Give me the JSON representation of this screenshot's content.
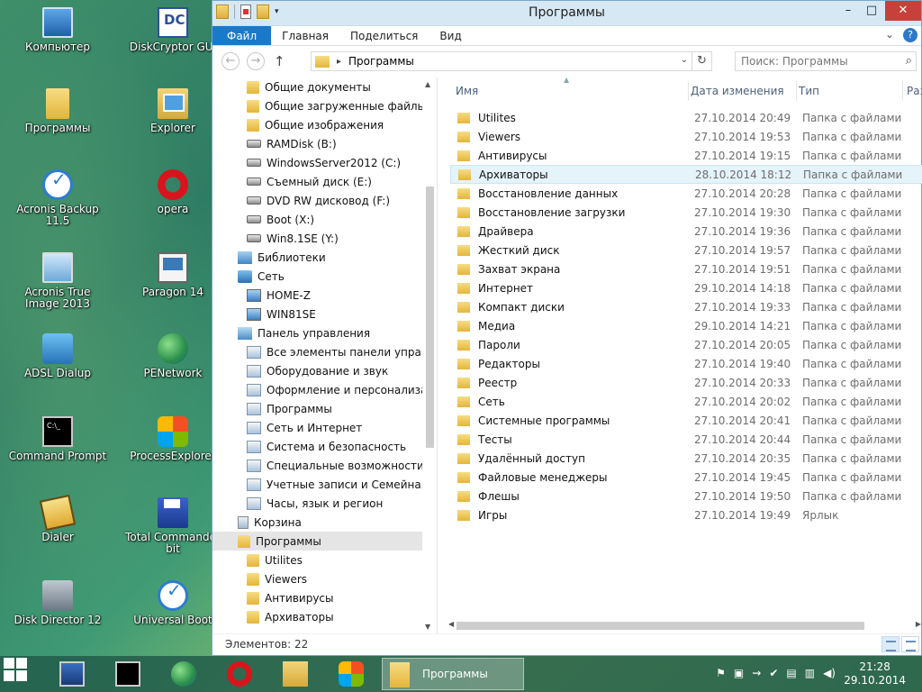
{
  "desktop": {
    "icons": [
      {
        "label": "Компьютер",
        "icon": "computer-icon"
      },
      {
        "label": "DiskCryptor GUI",
        "icon": "diskcryptor-icon"
      },
      {
        "label": "Программы",
        "icon": "folder-icon"
      },
      {
        "label": "Explorer",
        "icon": "explorer-icon"
      },
      {
        "label": "Acronis Backup 11.5",
        "icon": "acronis-icon"
      },
      {
        "label": "opera",
        "icon": "opera-icon"
      },
      {
        "label": "Acronis True Image 2013",
        "icon": "acronis-trueimage-icon"
      },
      {
        "label": "Paragon 14",
        "icon": "paragon-icon"
      },
      {
        "label": "ADSL Dialup",
        "icon": "network-icon"
      },
      {
        "label": "PENetwork",
        "icon": "globe-icon"
      },
      {
        "label": "Command Prompt",
        "icon": "cmd-icon"
      },
      {
        "label": "ProcessExplorer",
        "icon": "process-explorer-icon"
      },
      {
        "label": "Dialer",
        "icon": "dialer-icon"
      },
      {
        "label": "Total Commander bit",
        "icon": "total-commander-icon"
      },
      {
        "label": "Disk Director 12",
        "icon": "disk-director-icon"
      },
      {
        "label": "Universal Boot",
        "icon": "universal-boot-icon"
      }
    ]
  },
  "window": {
    "title": "Программы",
    "ribbon": {
      "tabs": [
        "Файл",
        "Главная",
        "Поделиться",
        "Вид"
      ]
    },
    "address": {
      "path": "Программы"
    },
    "search": {
      "placeholder": "Поиск: Программы"
    },
    "nav": {
      "items": [
        {
          "label": "Общие документы",
          "icon": "folder"
        },
        {
          "label": "Общие загруженные файлы",
          "icon": "folder"
        },
        {
          "label": "Общие изображения",
          "icon": "folder"
        },
        {
          "label": "RAMDisk (B:)",
          "icon": "drive"
        },
        {
          "label": "WindowsServer2012 (C:)",
          "icon": "drive"
        },
        {
          "label": "Съемный диск (E:)",
          "icon": "drive"
        },
        {
          "label": "DVD RW дисковод (F:)",
          "icon": "drive"
        },
        {
          "label": "Boot (X:)",
          "icon": "drive"
        },
        {
          "label": "Win8.1SE (Y:)",
          "icon": "drive"
        },
        {
          "label": "Библиотеки",
          "icon": "lib"
        },
        {
          "label": "Сеть",
          "icon": "netw"
        },
        {
          "label": "HOME-Z",
          "icon": "comp"
        },
        {
          "label": "WIN81SE",
          "icon": "comp"
        },
        {
          "label": "Панель управления",
          "icon": "cp"
        },
        {
          "label": "Все элементы панели управления",
          "icon": "cpi"
        },
        {
          "label": "Оборудование и звук",
          "icon": "cpi"
        },
        {
          "label": "Оформление и персонализация",
          "icon": "cpi"
        },
        {
          "label": "Программы",
          "icon": "cpi"
        },
        {
          "label": "Сеть и Интернет",
          "icon": "cpi"
        },
        {
          "label": "Система и безопасность",
          "icon": "cpi"
        },
        {
          "label": "Специальные возможности",
          "icon": "cpi"
        },
        {
          "label": "Учетные записи и Семейная безопасность",
          "icon": "cpi"
        },
        {
          "label": "Часы, язык и регион",
          "icon": "cpi"
        },
        {
          "label": "Корзина",
          "icon": "bin"
        },
        {
          "label": "Программы",
          "icon": "folder"
        },
        {
          "label": "Utilites",
          "icon": "folder"
        },
        {
          "label": "Viewers",
          "icon": "folder"
        },
        {
          "label": "Антивирусы",
          "icon": "folder"
        },
        {
          "label": "Архиваторы",
          "icon": "folder"
        }
      ]
    },
    "columns": {
      "name": "Имя",
      "date": "Дата изменения",
      "type": "Тип",
      "size": "Разме"
    },
    "files": [
      {
        "name": "Utilites",
        "date": "27.10.2014 20:49",
        "type": "Папка с файлами"
      },
      {
        "name": "Viewers",
        "date": "27.10.2014 19:53",
        "type": "Папка с файлами"
      },
      {
        "name": "Антивирусы",
        "date": "27.10.2014 19:15",
        "type": "Папка с файлами"
      },
      {
        "name": "Архиваторы",
        "date": "28.10.2014 18:12",
        "type": "Папка с файлами"
      },
      {
        "name": "Восстановление данных",
        "date": "27.10.2014 20:28",
        "type": "Папка с файлами"
      },
      {
        "name": "Восстановление загрузки",
        "date": "27.10.2014 19:30",
        "type": "Папка с файлами"
      },
      {
        "name": "Драйвера",
        "date": "27.10.2014 19:36",
        "type": "Папка с файлами"
      },
      {
        "name": "Жесткий диск",
        "date": "27.10.2014 19:57",
        "type": "Папка с файлами"
      },
      {
        "name": "Захват экрана",
        "date": "27.10.2014 19:51",
        "type": "Папка с файлами"
      },
      {
        "name": "Интернет",
        "date": "29.10.2014 14:18",
        "type": "Папка с файлами"
      },
      {
        "name": "Компакт диски",
        "date": "27.10.2014 19:33",
        "type": "Папка с файлами"
      },
      {
        "name": "Медиа",
        "date": "29.10.2014 14:21",
        "type": "Папка с файлами"
      },
      {
        "name": "Пароли",
        "date": "27.10.2014 20:05",
        "type": "Папка с файлами"
      },
      {
        "name": "Редакторы",
        "date": "27.10.2014 19:40",
        "type": "Папка с файлами"
      },
      {
        "name": "Реестр",
        "date": "27.10.2014 20:33",
        "type": "Папка с файлами"
      },
      {
        "name": "Сеть",
        "date": "27.10.2014 20:02",
        "type": "Папка с файлами"
      },
      {
        "name": "Системные программы",
        "date": "27.10.2014 20:41",
        "type": "Папка с файлами"
      },
      {
        "name": "Тесты",
        "date": "27.10.2014 20:44",
        "type": "Папка с файлами"
      },
      {
        "name": "Удалённый доступ",
        "date": "27.10.2014 20:35",
        "type": "Папка с файлами"
      },
      {
        "name": "Файловые менеджеры",
        "date": "27.10.2014 19:45",
        "type": "Папка с файлами"
      },
      {
        "name": "Флешы",
        "date": "27.10.2014 19:50",
        "type": "Папка с файлами"
      },
      {
        "name": "Игры",
        "date": "27.10.2014 19:49",
        "type": "Ярлык"
      }
    ],
    "selected_file": "Архиваторы",
    "selected_nav": "Программы",
    "status": "Элементов: 22"
  },
  "taskbar": {
    "active_label": "Программы",
    "clock_time": "21:28",
    "clock_date": "29.10.2014"
  },
  "colors": {
    "accent": "#1979ca",
    "selection": "#e5f3fb",
    "close": "#c7403a"
  }
}
